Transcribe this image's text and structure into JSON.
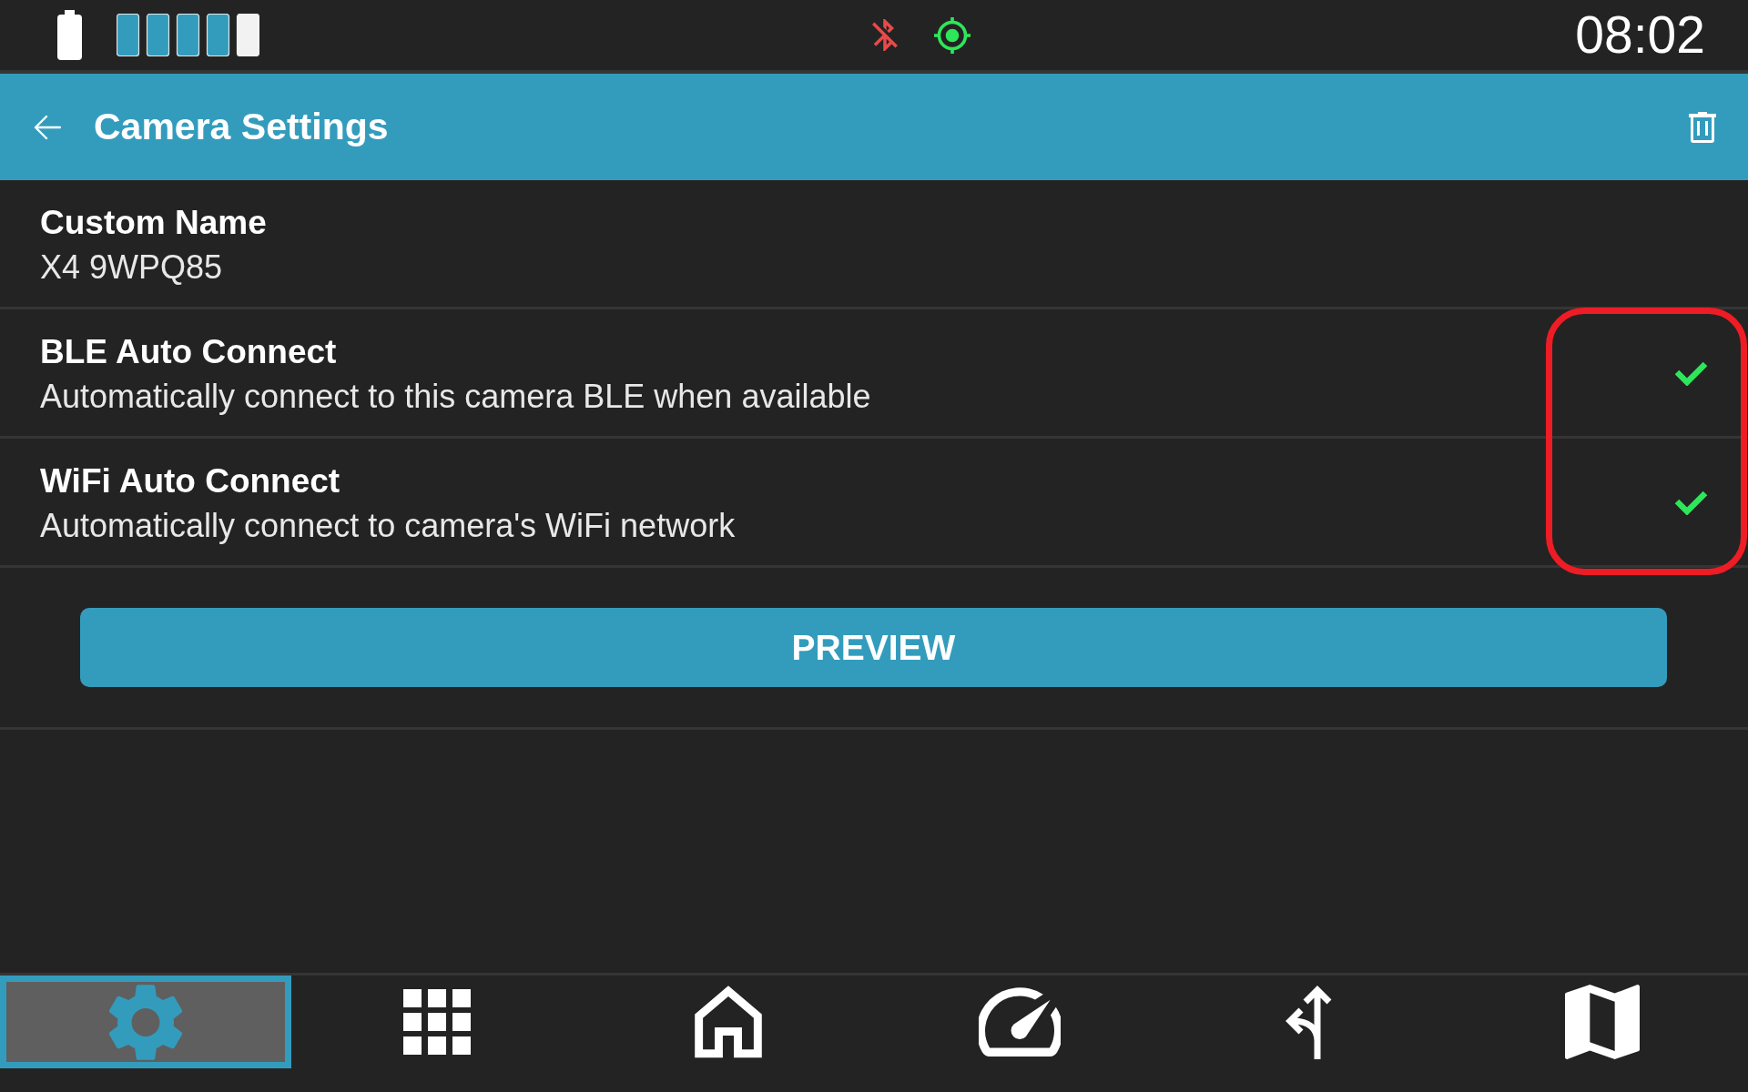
{
  "status_bar": {
    "time": "08:02"
  },
  "header": {
    "title": "Camera Settings"
  },
  "settings": [
    {
      "kind": "text",
      "title": "Custom Name",
      "value": "X4 9WPQ85",
      "highlighted": false
    },
    {
      "kind": "toggle",
      "title": "BLE Auto Connect",
      "description": "Automatically connect to this camera BLE when available",
      "checked": true,
      "highlighted": true
    },
    {
      "kind": "toggle",
      "title": "WiFi Auto Connect",
      "description": "Automatically connect to camera's WiFi network",
      "checked": true,
      "highlighted": true
    }
  ],
  "preview_button": {
    "label": "PREVIEW"
  },
  "bottom_nav": [
    {
      "selected": true
    },
    {
      "selected": false
    },
    {
      "selected": false
    },
    {
      "selected": false
    },
    {
      "selected": false
    },
    {
      "selected": false
    }
  ]
}
